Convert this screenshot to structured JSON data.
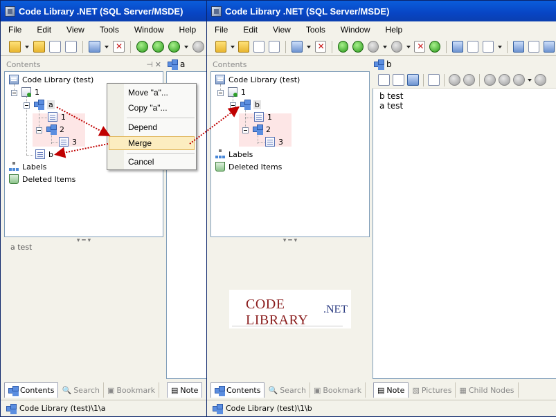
{
  "window_title": "Code Library .NET (SQL Server/MSDE)",
  "menu": [
    "File",
    "Edit",
    "View",
    "Tools",
    "Window",
    "Help"
  ],
  "panel_title": "Contents",
  "left_window": {
    "tree": {
      "root": "Code Library (test)",
      "n1": "1",
      "n_a": "a",
      "n_a_1": "1",
      "n_a_2": "2",
      "n_a_3": "3",
      "n_b": "b",
      "labels": "Labels",
      "deleted": "Deleted Items"
    },
    "preview_text": "a test",
    "editor_title": "a",
    "editor_tab": "Note",
    "tabs": [
      "Contents",
      "Search",
      "Bookmark"
    ],
    "status": "Code Library (test)\\1\\a"
  },
  "context_menu": {
    "items": [
      "Move \"a\"...",
      "Copy \"a\"...",
      "Depend",
      "Merge",
      "Cancel"
    ],
    "highlighted": "Merge"
  },
  "right_window": {
    "tree": {
      "root": "Code Library (test)",
      "n1": "1",
      "n_b": "b",
      "n_b_1": "1",
      "n_b_2": "2",
      "n_b_3": "3",
      "labels": "Labels",
      "deleted": "Deleted Items"
    },
    "editor_title": "b",
    "editor_lines": [
      "b test",
      "a test"
    ],
    "logo_main": "CODE LIBRARY",
    "logo_sub": ".NET",
    "tabs": [
      "Contents",
      "Search",
      "Bookmark"
    ],
    "editor_tabs": [
      "Note",
      "Pictures",
      "Child Nodes"
    ],
    "status": "Code Library (test)\\1\\b"
  },
  "colors": {
    "title_bar": "#0a4fd0",
    "highlight": "#fcedc0",
    "merge_pink": "#fde6e6",
    "arrow": "#c00000",
    "logo": "#8a1c1c"
  }
}
